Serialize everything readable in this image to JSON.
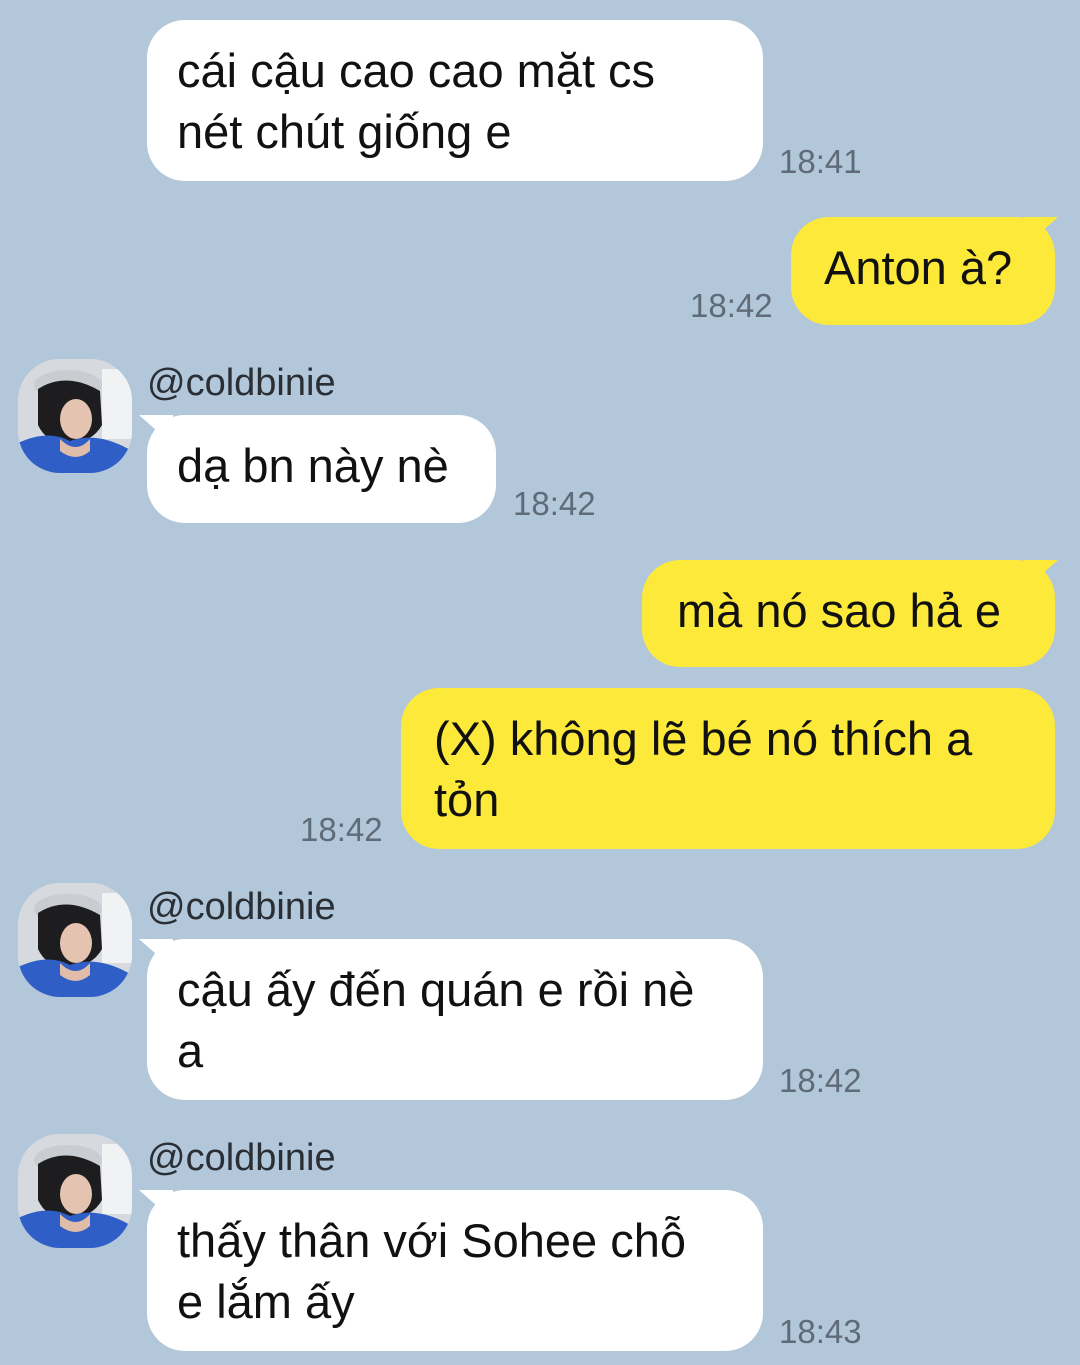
{
  "colors": {
    "background": "#b2c7da",
    "incoming_bubble": "#ffffff",
    "outgoing_bubble": "#fde93a",
    "timestamp": "#5f6b78"
  },
  "messages": [
    {
      "direction": "incoming",
      "text": "cái cậu cao cao mặt cs\nnét chút giống e",
      "time": "18:41"
    },
    {
      "direction": "outgoing",
      "text": "Anton à?",
      "time": "18:42"
    },
    {
      "direction": "incoming",
      "sender": "@coldbinie",
      "avatar_icon": "profile-photo",
      "text": "dạ bn này nè",
      "time": "18:42"
    },
    {
      "direction": "outgoing",
      "text": "mà nó sao hả e"
    },
    {
      "direction": "outgoing",
      "text": "(X) không lẽ bé nó thích a\ntỏn",
      "time": "18:42"
    },
    {
      "direction": "incoming",
      "sender": "@coldbinie",
      "avatar_icon": "profile-photo",
      "text": "cậu ấy đến quán e rồi nè\na",
      "time": "18:42"
    },
    {
      "direction": "incoming",
      "sender": "@coldbinie",
      "avatar_icon": "profile-photo",
      "text": "thấy thân với Sohee chỗ\ne lắm ấy",
      "time": "18:43"
    }
  ]
}
